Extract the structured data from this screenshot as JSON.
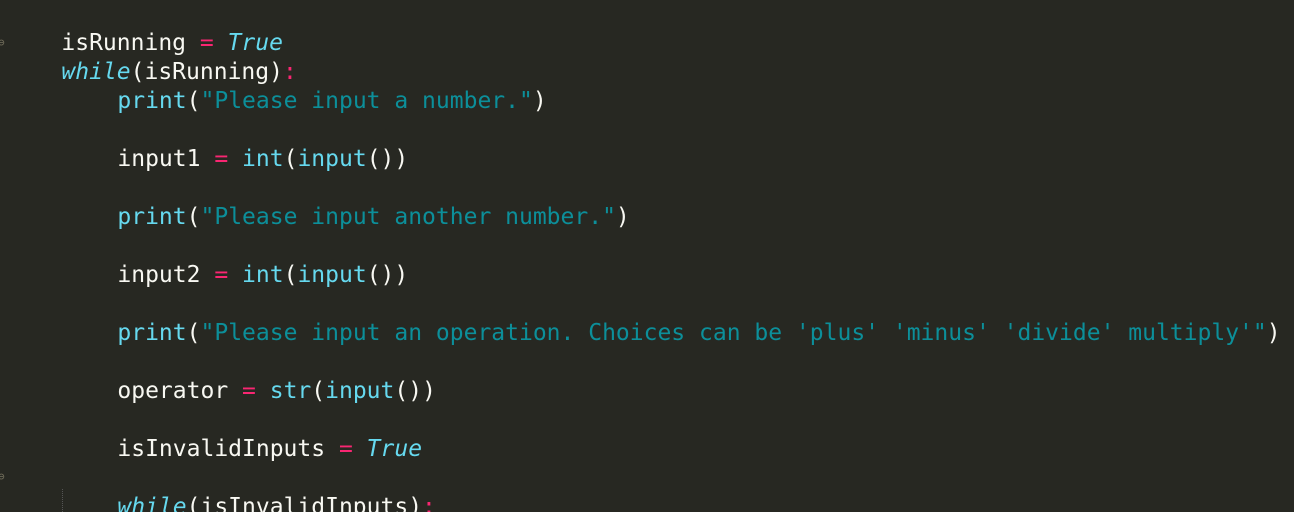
{
  "code": {
    "l1": {
      "a": "isRunning",
      "b": " = ",
      "c": "True"
    },
    "l2": {
      "a": "while",
      "b": "(isRunning)",
      "c": ":"
    },
    "l3": {
      "a": "print",
      "b": "(",
      "c": "\"Please input a number.\"",
      "d": ")"
    },
    "l5": {
      "a": "input1",
      "b": " = ",
      "c": "int",
      "d": "(",
      "e": "input",
      "f": "())"
    },
    "l7": {
      "a": "print",
      "b": "(",
      "c": "\"Please input another number.\"",
      "d": ")"
    },
    "l9": {
      "a": "input2",
      "b": " = ",
      "c": "int",
      "d": "(",
      "e": "input",
      "f": "())"
    },
    "l11": {
      "a": "print",
      "b": "(",
      "c": "\"Please input an operation. Choices can be 'plus' 'minus' 'divide' multiply'\"",
      "d": ")"
    },
    "l13": {
      "a": "operator",
      "b": " = ",
      "c": "str",
      "d": "(",
      "e": "input",
      "f": "())"
    },
    "l15": {
      "a": "isInvalidInputs",
      "b": " = ",
      "c": "True"
    },
    "l17": {
      "a": "while",
      "b": "(isInvalidInputs)",
      "c": ":"
    }
  },
  "colors": {
    "background": "#272822",
    "keyword": "#66d9ef",
    "operator": "#f92672",
    "string": "#0c8f9a",
    "text": "#f8f8f2"
  }
}
